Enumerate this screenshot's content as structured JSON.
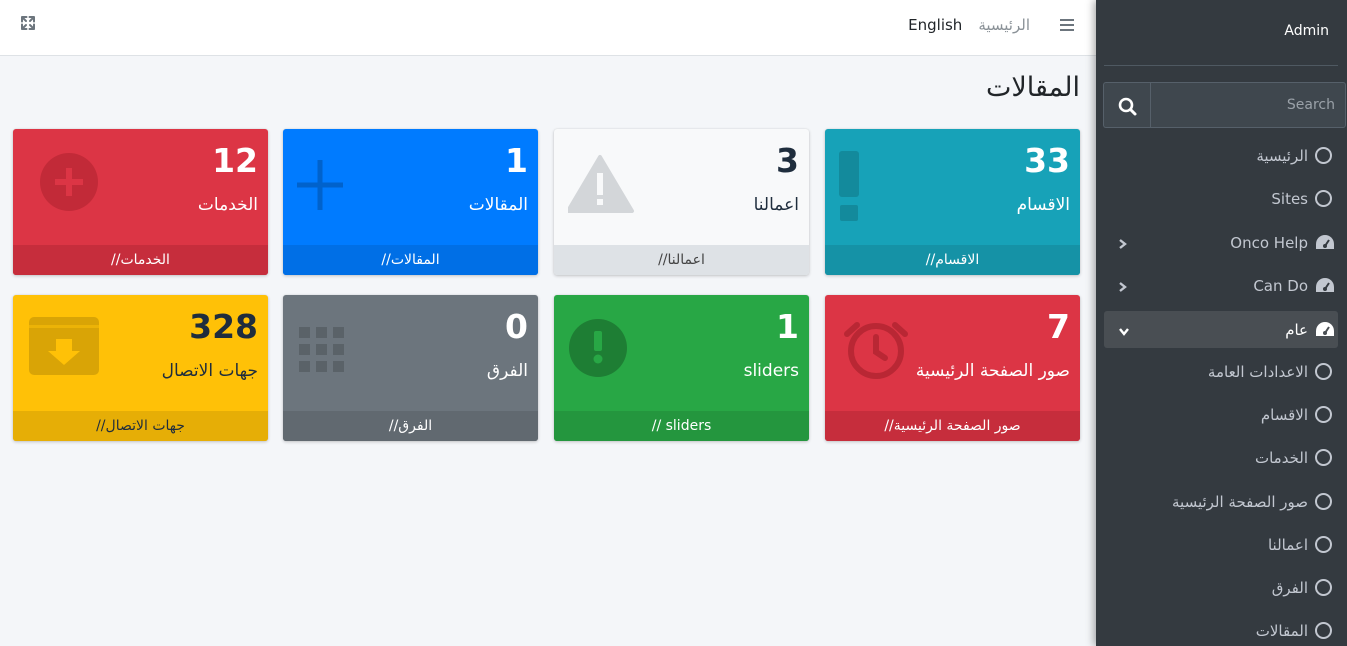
{
  "navbar": {
    "english_label": "English",
    "home_label": "الرئيسية"
  },
  "page": {
    "title": "المقالات"
  },
  "boxes": [
    {
      "number": "12",
      "label": "الخدمات",
      "footer": "الخدمات//",
      "icon": "plus-circle-icon",
      "color": "#dc3545"
    },
    {
      "number": "1",
      "label": "المقالات",
      "footer": "المقالات//",
      "icon": "plus-icon",
      "color": "#007bff"
    },
    {
      "number": "3",
      "label": "اعمالنا",
      "footer": "اعمالنا//",
      "icon": "warning-triangle-icon",
      "color": "#f8f9fa"
    },
    {
      "number": "33",
      "label": "الاقسام",
      "footer": "الاقسام//",
      "icon": "exclamation-icon",
      "color": "#17a2b8"
    },
    {
      "number": "328",
      "label": "جهات الاتصال",
      "footer": "جهات الاتصال//",
      "icon": "archive-download-icon",
      "color": "#ffc107"
    },
    {
      "number": "0",
      "label": "الفرق",
      "footer": "الفرق//",
      "icon": "grid-icon",
      "color": "#6c757d"
    },
    {
      "number": "1",
      "label": "sliders",
      "footer": "sliders //",
      "icon": "exclamation-circle-icon",
      "color": "#28a745"
    },
    {
      "number": "7",
      "label": "صور الصفحة الرئيسية",
      "footer": "صور الصفحة الرئيسية//",
      "icon": "alarm-clock-icon",
      "color": "#dc3545"
    }
  ],
  "sidebar": {
    "brand": "Admin",
    "search_placeholder": "Search",
    "items": [
      {
        "label": "الرئيسية",
        "icon": "circle-icon"
      },
      {
        "label": "Sites",
        "icon": "circle-icon"
      },
      {
        "label": "Onco Help",
        "icon": "dashboard-icon",
        "arrow": "chevron-left-icon"
      },
      {
        "label": "Can Do",
        "icon": "dashboard-icon",
        "arrow": "chevron-left-icon"
      },
      {
        "label": "عام",
        "icon": "dashboard-icon",
        "arrow": "chevron-down-icon",
        "active": true
      },
      {
        "label": "الاعدادات العامة",
        "icon": "circle-icon"
      },
      {
        "label": "الاقسام",
        "icon": "circle-icon"
      },
      {
        "label": "الخدمات",
        "icon": "circle-icon"
      },
      {
        "label": "صور الصفحة الرئيسية",
        "icon": "circle-icon"
      },
      {
        "label": "اعمالنا",
        "icon": "circle-icon"
      },
      {
        "label": "الفرق",
        "icon": "circle-icon"
      },
      {
        "label": "المقالات",
        "icon": "circle-icon"
      }
    ]
  }
}
